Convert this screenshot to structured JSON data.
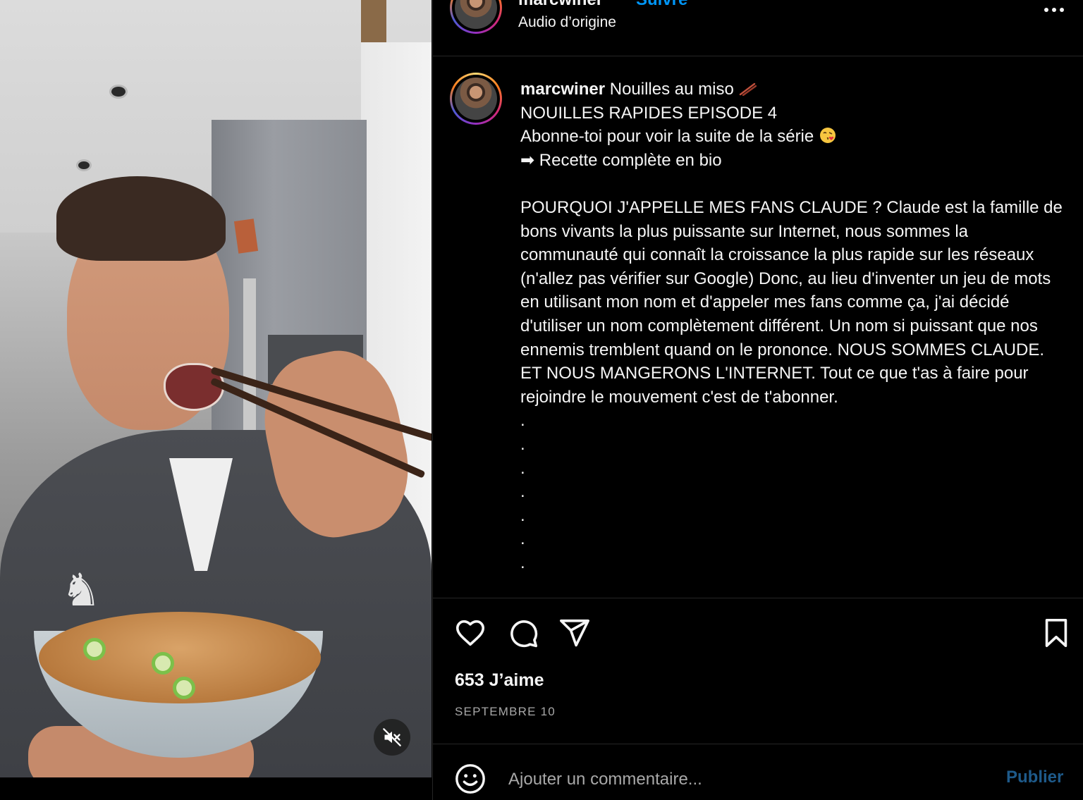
{
  "header": {
    "username": "marcwiner",
    "follow_label": "Suivre",
    "audio_label": "Audio d’origine",
    "more_icon": "more-horizontal-icon"
  },
  "caption": {
    "username": "marcwiner",
    "title": "Nouilles au miso",
    "title_emoji": "chopsticks",
    "lines": [
      "NOUILLES RAPIDES EPISODE 4",
      "Abonne-toi pour voir la suite de la série",
      "➡ Recette complète en bio"
    ],
    "kiss_emoji": "face-blowing-kiss",
    "body": "POURQUOI J'APPELLE MES FANS CLAUDE ? Claude est la famille de bons vivants la plus puissante sur Internet, nous sommes la communauté qui connaît la croissance la plus rapide sur les réseaux (n'allez pas vérifier sur Google) Donc, au lieu d'inventer un jeu de mots en utilisant mon nom et d'appeler mes fans comme ça, j'ai décidé d'utiliser un nom complètement différent. Un nom si puissant que nos ennemis tremblent quand on le prononce. NOUS SOMMES CLAUDE. ET NOUS MANGERONS L'INTERNET. Tout ce que t'as à faire pour rejoindre le mouvement c'est de t'abonner.",
    "dots": [
      ".",
      ".",
      ".",
      ".",
      ".",
      ".",
      "."
    ]
  },
  "actions": {
    "like_icon": "heart-icon",
    "comment_icon": "comment-icon",
    "share_icon": "share-icon",
    "save_icon": "bookmark-icon"
  },
  "likes": "653 J’aime",
  "date": "SEPTEMBRE 10",
  "comment": {
    "placeholder": "Ajouter un commentaire...",
    "publish_label": "Publier",
    "emoji_icon": "smiley-icon"
  },
  "media": {
    "mute_icon": "muted-speaker-icon"
  },
  "colors": {
    "accent": "#0095f6",
    "publish_disabled": "#1e5a8a",
    "secondary_text": "#a8a8a8",
    "divider": "#262626"
  }
}
